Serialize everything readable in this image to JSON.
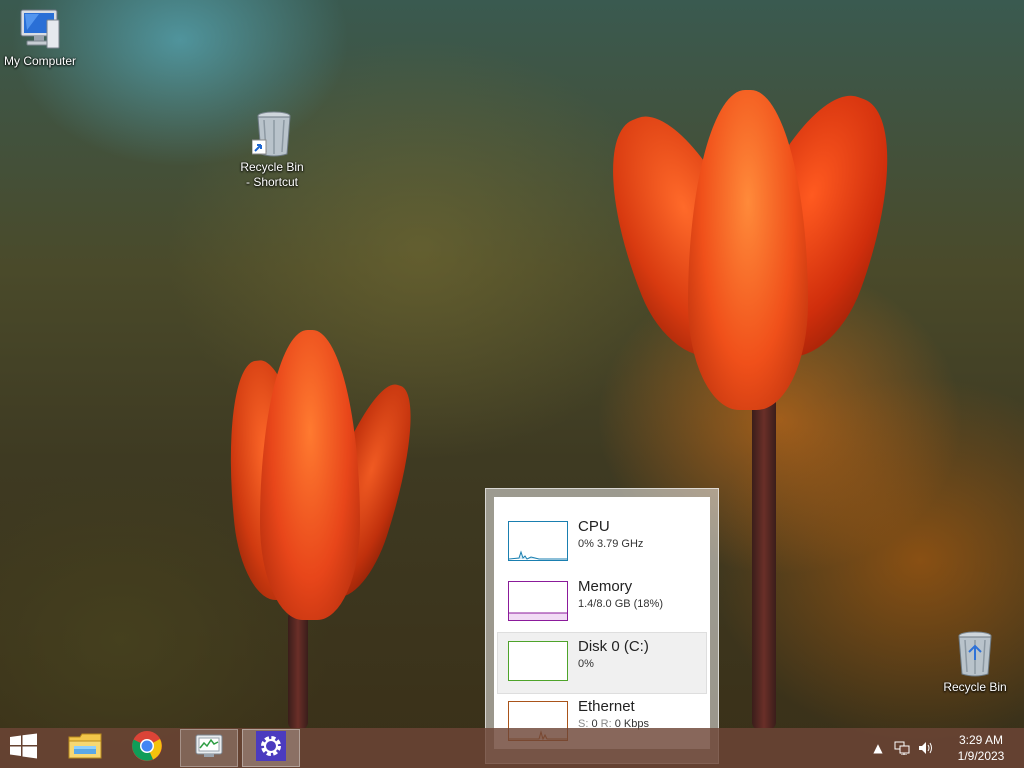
{
  "desktop": {
    "icons": [
      {
        "label": "My Computer"
      },
      {
        "label": "Recycle Bin - Shortcut"
      },
      {
        "label": "Recycle Bin"
      }
    ]
  },
  "performance_flyout": {
    "items": [
      {
        "name": "CPU",
        "detail": "0%  3.79 GHz",
        "color": "#1a7fb0",
        "active": false
      },
      {
        "name": "Memory",
        "detail": "1.4/8.0 GB (18%)",
        "color": "#8b1a9b",
        "active": false
      },
      {
        "name": "Disk 0 (C:)",
        "detail": "0%",
        "color": "#4ea42a",
        "active": true
      },
      {
        "name": "Ethernet",
        "detail_s_label": "S:",
        "detail_s_value": "0",
        "detail_r_label": "R:",
        "detail_r_value": "0 Kbps",
        "color": "#a9541a",
        "active": false
      }
    ]
  },
  "taskbar": {
    "buttons": [
      {
        "icon": "windows-start-icon"
      },
      {
        "icon": "file-explorer-icon"
      },
      {
        "icon": "chrome-icon"
      },
      {
        "icon": "task-manager-icon"
      },
      {
        "icon": "settings-gear-icon"
      }
    ],
    "tray": {
      "icons": [
        "show-hidden-icons-chevron",
        "network-icon",
        "volume-icon"
      ],
      "time": "3:29 AM",
      "date": "1/9/2023"
    }
  }
}
